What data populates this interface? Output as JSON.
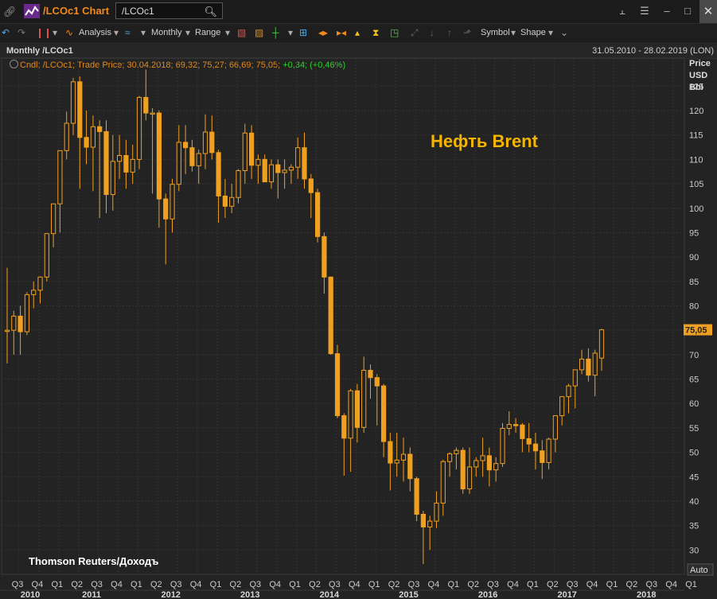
{
  "window": {
    "link_icon": "link-icon",
    "logo_icon": "chart-logo-icon",
    "title": "/LCOc1 Chart",
    "search_value": "/LCOc1",
    "controls": [
      "tree-icon",
      "menu-icon",
      "minimize-icon",
      "maximize-icon",
      "close-icon"
    ]
  },
  "toolbar": {
    "analysis": "Analysis",
    "interval": "Monthly",
    "range": "Range",
    "symbol": "Symbol",
    "shape": "Shape"
  },
  "infobar": {
    "label": "Monthly /LCOc1",
    "date_range": "31.05.2010 - 28.02.2019 (LON)"
  },
  "legend": {
    "text": "Cndl; /LCOc1; Trade Price; 30.04.2018; 69,32; 75,27; 66,69; 75,05;",
    "change": " +0,34; (+0,46%)"
  },
  "axis_units": [
    "Price",
    "USD",
    "Bbl"
  ],
  "last_price_label": "75,05",
  "auto_label": "Auto",
  "annotations": {
    "title": "Нефть Brent",
    "title_color": "#f5b400",
    "source": "Thomson Reuters/Доходъ"
  },
  "colors": {
    "candle": "#f0a020",
    "background": "#232323",
    "grid": "#333333",
    "axis_text": "#cccccc",
    "last_price_bg": "#f0a020"
  },
  "chart_data": {
    "type": "candlestick",
    "instrument": "/LCOc1",
    "interval": "Monthly",
    "ylim": [
      25,
      130
    ],
    "y_ticks": [
      30,
      35,
      40,
      45,
      50,
      55,
      60,
      65,
      70,
      75,
      80,
      85,
      90,
      95,
      100,
      105,
      110,
      115,
      120,
      125
    ],
    "quarter_labels": [
      "Q3",
      "Q4",
      "Q1",
      "Q2",
      "Q3",
      "Q4",
      "Q1",
      "Q2",
      "Q3",
      "Q4",
      "Q1",
      "Q2",
      "Q3",
      "Q4",
      "Q1",
      "Q2",
      "Q3",
      "Q4",
      "Q1",
      "Q2",
      "Q3",
      "Q4",
      "Q1",
      "Q2",
      "Q3",
      "Q4",
      "Q1",
      "Q2",
      "Q3",
      "Q4",
      "Q1",
      "Q2",
      "Q3",
      "Q4",
      "Q1"
    ],
    "year_labels": [
      "2010",
      "2011",
      "2012",
      "2013",
      "2014",
      "2015",
      "2016",
      "2017",
      "2018"
    ],
    "start_month": "2010-06",
    "candles": [
      [
        74.9,
        87.8,
        68.2,
        75.0
      ],
      [
        75.0,
        79.0,
        70.0,
        77.9
      ],
      [
        77.9,
        80.0,
        70.0,
        74.7
      ],
      [
        74.7,
        82.8,
        74.0,
        82.3
      ],
      [
        82.3,
        85.0,
        79.5,
        83.2
      ],
      [
        83.2,
        86.0,
        80.5,
        85.9
      ],
      [
        85.9,
        94.8,
        85.0,
        94.8
      ],
      [
        94.8,
        98.0,
        92.0,
        100.9
      ],
      [
        100.9,
        104.0,
        95.0,
        111.8
      ],
      [
        111.8,
        119.8,
        110.0,
        117.4
      ],
      [
        117.4,
        126.7,
        115.0,
        125.9
      ],
      [
        125.9,
        127.0,
        104.0,
        114.5
      ],
      [
        114.5,
        120.0,
        109.0,
        112.5
      ],
      [
        112.5,
        119.0,
        103.5,
        116.7
      ],
      [
        116.7,
        118.0,
        98.0,
        115.7
      ],
      [
        115.7,
        118.0,
        99.0,
        102.8
      ],
      [
        102.8,
        115.0,
        99.5,
        109.6
      ],
      [
        109.6,
        115.0,
        106.0,
        110.8
      ],
      [
        110.8,
        114.0,
        104.0,
        107.4
      ],
      [
        107.4,
        113.0,
        105.0,
        110.0
      ],
      [
        110.0,
        123.0,
        108.0,
        122.7
      ],
      [
        122.7,
        128.4,
        118.0,
        119.5
      ],
      [
        119.5,
        120.5,
        103.0,
        119.5
      ],
      [
        119.5,
        120.0,
        96.0,
        101.9
      ],
      [
        101.9,
        103.0,
        88.5,
        97.8
      ],
      [
        97.8,
        106.0,
        95.0,
        104.9
      ],
      [
        104.9,
        117.0,
        103.5,
        113.5
      ],
      [
        113.5,
        117.0,
        107.0,
        112.4
      ],
      [
        112.4,
        114.0,
        107.5,
        108.7
      ],
      [
        108.7,
        112.0,
        105.0,
        111.2
      ],
      [
        111.2,
        119.2,
        108.0,
        115.6
      ],
      [
        115.6,
        119.0,
        110.0,
        111.4
      ],
      [
        111.4,
        112.0,
        97.0,
        102.5
      ],
      [
        102.5,
        106.0,
        98.0,
        100.4
      ],
      [
        100.4,
        105.0,
        99.0,
        102.2
      ],
      [
        102.2,
        108.0,
        101.0,
        107.7
      ],
      [
        107.7,
        117.3,
        105.0,
        115.4
      ],
      [
        115.4,
        117.0,
        106.0,
        108.8
      ],
      [
        108.8,
        111.0,
        105.0,
        110.0
      ],
      [
        110.0,
        111.0,
        106.0,
        105.4
      ],
      [
        105.4,
        110.0,
        104.0,
        108.9
      ],
      [
        108.9,
        110.0,
        102.0,
        107.3
      ],
      [
        107.3,
        110.0,
        104.0,
        107.8
      ],
      [
        107.8,
        109.0,
        105.0,
        108.4
      ],
      [
        108.4,
        114.5,
        106.0,
        112.4
      ],
      [
        112.4,
        115.5,
        104.0,
        106.0
      ],
      [
        106.0,
        107.0,
        98.0,
        103.2
      ],
      [
        103.2,
        104.0,
        93.0,
        94.2
      ],
      [
        94.2,
        95.0,
        82.5,
        85.9
      ],
      [
        85.9,
        86.0,
        70.0,
        70.2
      ],
      [
        70.2,
        72.0,
        57.0,
        57.5
      ],
      [
        57.5,
        58.0,
        45.2,
        52.9
      ],
      [
        52.9,
        63.0,
        46.0,
        62.6
      ],
      [
        62.6,
        64.0,
        52.0,
        55.1
      ],
      [
        55.1,
        69.6,
        54.0,
        66.8
      ],
      [
        66.8,
        68.0,
        61.0,
        65.3
      ],
      [
        65.3,
        66.0,
        55.5,
        63.6
      ],
      [
        63.6,
        64.0,
        49.0,
        52.2
      ],
      [
        52.2,
        54.0,
        42.2,
        47.8
      ],
      [
        47.8,
        54.0,
        45.0,
        48.4
      ],
      [
        48.4,
        53.0,
        44.0,
        49.6
      ],
      [
        49.6,
        51.0,
        42.0,
        44.6
      ],
      [
        44.6,
        45.0,
        35.9,
        37.3
      ],
      [
        37.3,
        38.0,
        27.1,
        34.7
      ],
      [
        34.7,
        37.0,
        30.0,
        35.9
      ],
      [
        35.9,
        42.0,
        34.5,
        39.6
      ],
      [
        39.6,
        48.5,
        37.0,
        48.1
      ],
      [
        48.1,
        50.0,
        45.0,
        49.7
      ],
      [
        49.7,
        51.0,
        46.5,
        50.4
      ],
      [
        50.4,
        51.0,
        41.5,
        42.5
      ],
      [
        42.5,
        51.0,
        41.5,
        47.0
      ],
      [
        47.0,
        49.0,
        45.0,
        48.3
      ],
      [
        48.3,
        53.0,
        45.0,
        49.3
      ],
      [
        49.3,
        51.0,
        43.0,
        46.4
      ],
      [
        46.4,
        49.0,
        44.0,
        47.7
      ],
      [
        47.7,
        56.0,
        47.0,
        54.9
      ],
      [
        54.9,
        58.4,
        53.5,
        55.7
      ],
      [
        55.7,
        57.0,
        54.0,
        55.6
      ],
      [
        55.6,
        56.0,
        50.0,
        52.8
      ],
      [
        52.8,
        56.0,
        50.0,
        51.7
      ],
      [
        51.7,
        54.0,
        46.5,
        50.3
      ],
      [
        50.3,
        52.5,
        44.5,
        47.9
      ],
      [
        47.9,
        53.0,
        46.5,
        52.7
      ],
      [
        52.7,
        53.0,
        50.0,
        57.5
      ],
      [
        57.5,
        59.5,
        55.5,
        61.4
      ],
      [
        61.4,
        64.0,
        58.0,
        63.6
      ],
      [
        63.6,
        65.0,
        59.0,
        66.9
      ],
      [
        66.9,
        71.0,
        66.0,
        69.1
      ],
      [
        69.1,
        71.3,
        64.5,
        65.8
      ],
      [
        65.8,
        71.0,
        61.5,
        70.3
      ],
      [
        69.3,
        75.3,
        66.7,
        75.1
      ]
    ]
  }
}
